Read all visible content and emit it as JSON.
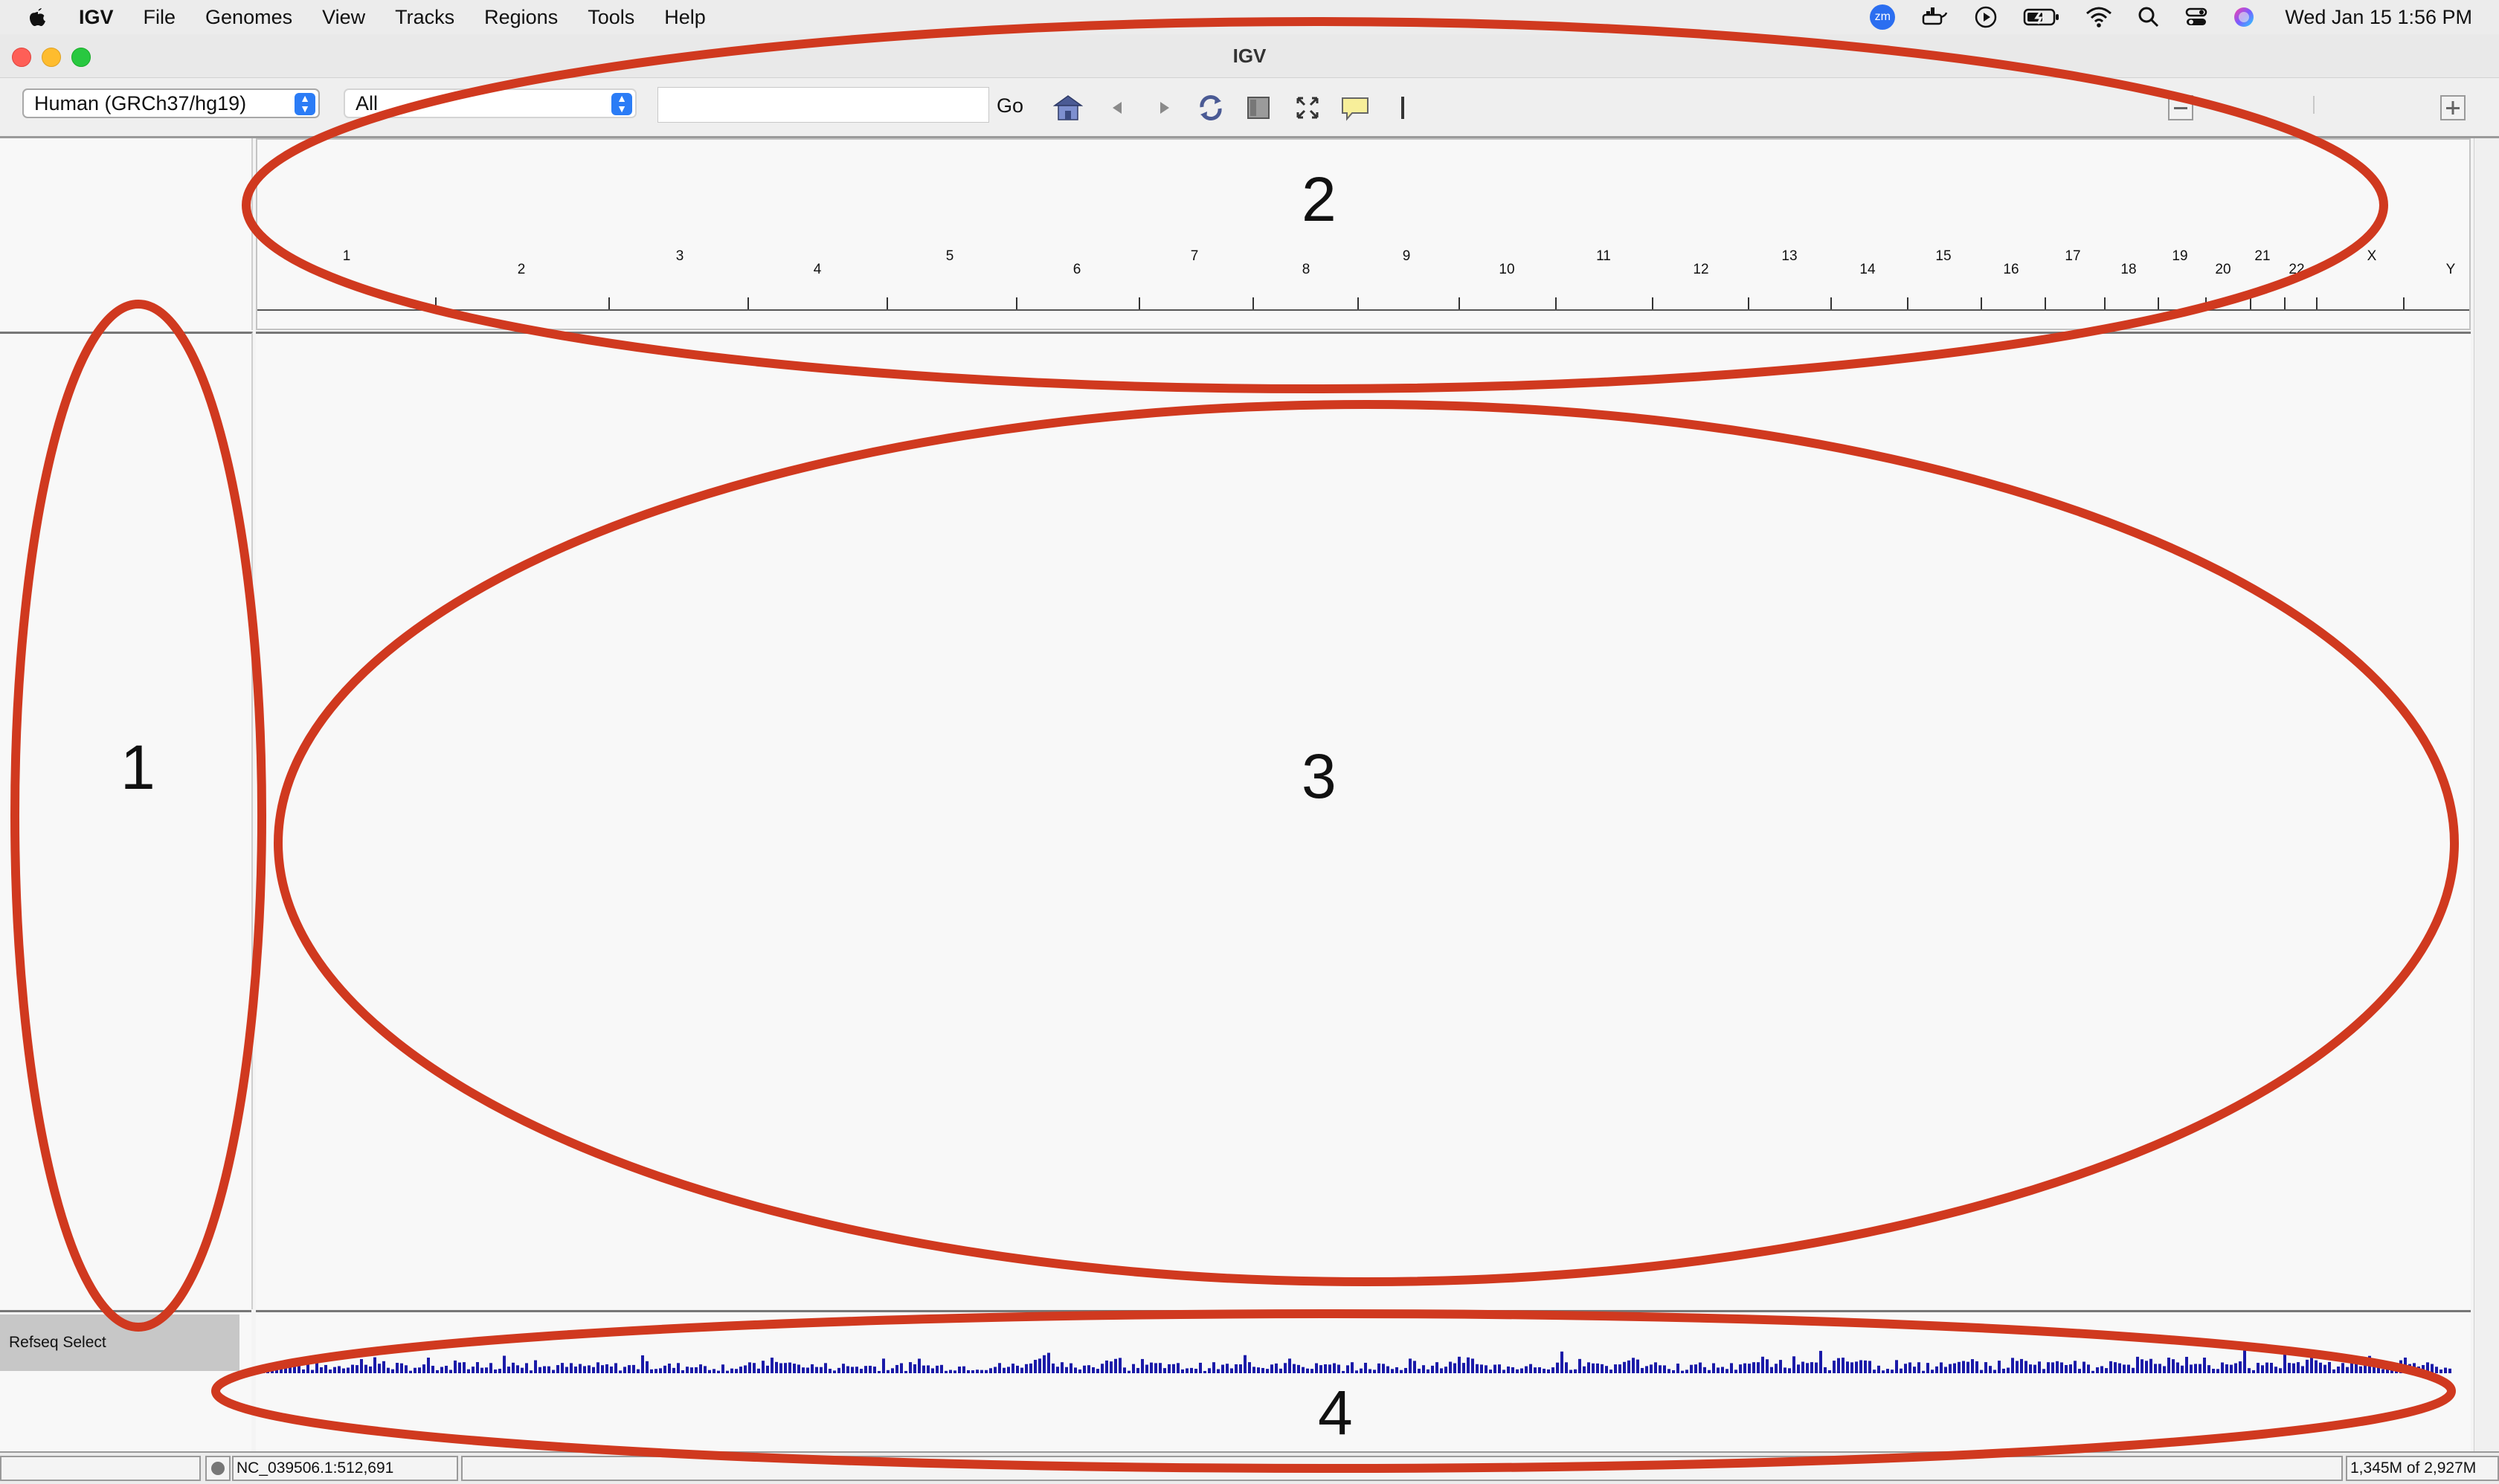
{
  "menubar": {
    "app_name": "IGV",
    "items": [
      "File",
      "Genomes",
      "View",
      "Tracks",
      "Regions",
      "Tools",
      "Help"
    ],
    "clock": "Wed Jan 15  1:56 PM",
    "zoom_badge": "zm"
  },
  "window": {
    "title": "IGV"
  },
  "toolbar": {
    "genome_value": "Human (GRCh37/hg19)",
    "chromosome_value": "All",
    "locus_value": "",
    "go_label": "Go"
  },
  "ruler": {
    "chromosomes": [
      "1",
      "2",
      "3",
      "4",
      "5",
      "6",
      "7",
      "8",
      "9",
      "10",
      "11",
      "12",
      "13",
      "14",
      "15",
      "16",
      "17",
      "18",
      "19",
      "20",
      "21",
      "22",
      "X",
      "Y"
    ]
  },
  "track": {
    "name": "Refseq Select"
  },
  "status": {
    "position": "NC_039506.1:512,691",
    "memory": "1,345M of 2,927M"
  },
  "annotations": {
    "labels": [
      "1",
      "2",
      "3",
      "4"
    ],
    "color": "#d0391f"
  },
  "colors": {
    "feature_bars": "#1a1aa8",
    "accent": "#2b7cf6"
  }
}
